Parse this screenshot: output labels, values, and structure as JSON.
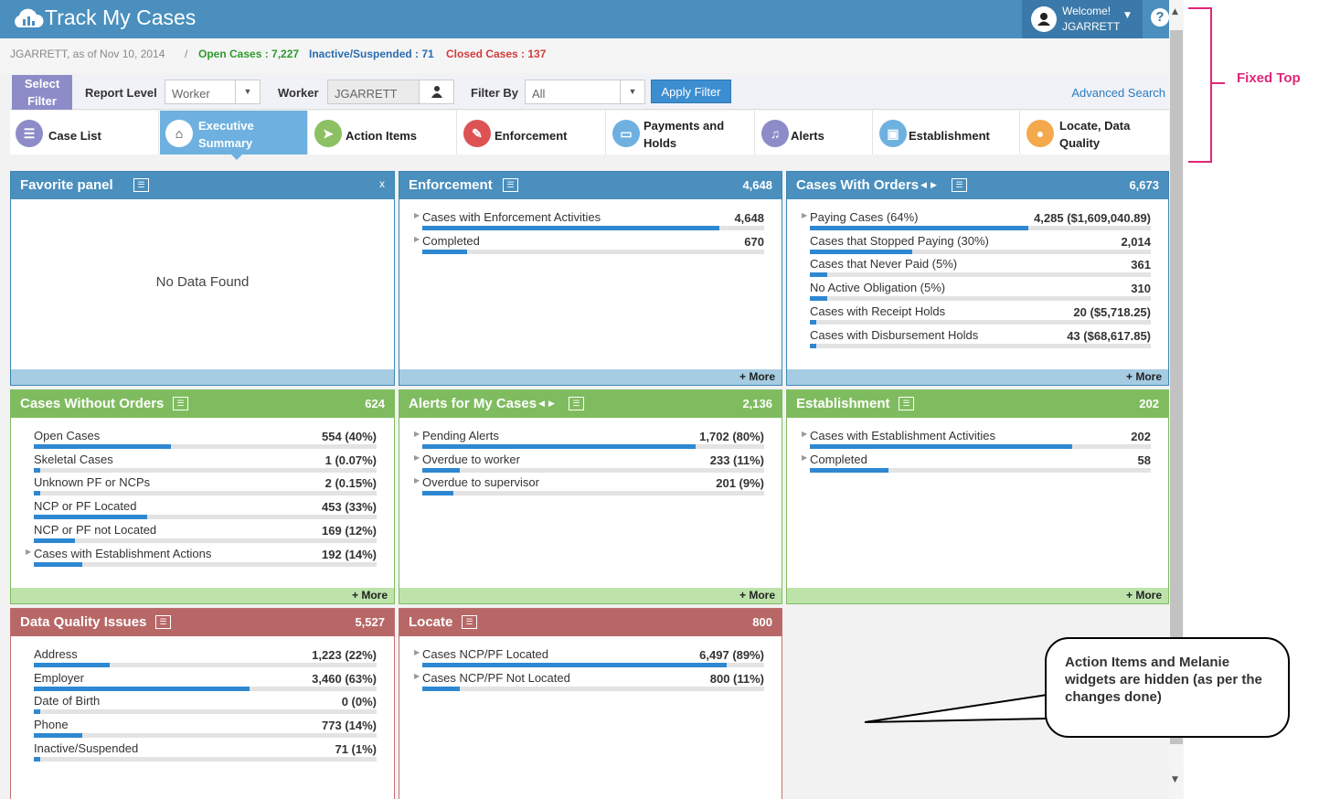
{
  "header": {
    "title": "Track My Cases",
    "welcome": "Welcome!",
    "user": "JGARRETT",
    "help": "?"
  },
  "subheader": {
    "user_date": "JGARRETT, as of Nov 10, 2014",
    "separator": "/",
    "open_label": "Open Cases : ",
    "open_value": "7,227",
    "inactive_label": "Inactive/Suspended : ",
    "inactive_value": "71",
    "closed_label": "Closed Cases : ",
    "closed_value": "137",
    "colors": {
      "open": "#2e9a2e",
      "inactive": "#2b6cb0",
      "closed": "#d23c3c"
    }
  },
  "filter": {
    "select_filter_line1": "Select",
    "select_filter_line2": "Filter",
    "report_level_label": "Report Level",
    "report_level_value": "Worker",
    "worker_label": "Worker",
    "worker_value": "JGARRETT",
    "filter_by_label": "Filter By",
    "filter_by_value": "All",
    "apply": "Apply Filter",
    "advanced": "Advanced Search"
  },
  "tabs": [
    {
      "label": "Case List",
      "icon": "list-icon",
      "color": "#8d8cc9"
    },
    {
      "label1": "Executive",
      "label2": "Summary",
      "icon": "home-icon",
      "active": true
    },
    {
      "label": "Action Items",
      "icon": "send-icon",
      "color": "#8cc063"
    },
    {
      "label": "Enforcement",
      "icon": "gavel-icon",
      "color": "#dd5353"
    },
    {
      "label1": "Payments and",
      "label2": "Holds",
      "icon": "money-icon",
      "color": "#6eb1e0"
    },
    {
      "label": "Alerts",
      "icon": "bell-icon",
      "color": "#8d8cc9"
    },
    {
      "label": "Establishment",
      "icon": "briefcase-icon",
      "color": "#6eb1e0"
    },
    {
      "label1": "Locate, Data",
      "label2": "Quality",
      "icon": "map-pin-icon",
      "color": "#f3a94c"
    }
  ],
  "panels": {
    "favorite": {
      "title": "Favorite panel",
      "close": "x",
      "empty": "No Data Found"
    },
    "enforcement": {
      "title": "Enforcement",
      "count": "4,648",
      "more": "+ More",
      "rows": [
        {
          "label": "Cases with Enforcement Activities",
          "value": "4,648",
          "pct": 0.87,
          "expand": true
        },
        {
          "label": "Completed",
          "value": "670",
          "pct": 0.13,
          "expand": true
        }
      ]
    },
    "orders": {
      "title": "Cases With Orders",
      "count": "6,673",
      "more": "+ More",
      "rows": [
        {
          "label": "Paying Cases (64%)",
          "value": "4,285 ($1,609,040.89)",
          "pct": 0.64,
          "expand": true
        },
        {
          "label": "Cases that Stopped Paying (30%)",
          "value": "2,014",
          "pct": 0.3
        },
        {
          "label": "Cases that Never Paid (5%)",
          "value": "361",
          "pct": 0.05
        },
        {
          "label": "No Active Obligation (5%)",
          "value": "310",
          "pct": 0.05
        },
        {
          "label": "Cases with Receipt Holds",
          "value": "20 ($5,718.25)",
          "pct": 0.01
        },
        {
          "label": "Cases with Disbursement Holds",
          "value": "43 ($68,617.85)",
          "pct": 0.01
        }
      ]
    },
    "without_orders": {
      "title": "Cases Without Orders",
      "count": "624",
      "more": "+ More",
      "rows": [
        {
          "label": "Open Cases",
          "value": "554 (40%)",
          "pct": 0.4
        },
        {
          "label": "Skeletal Cases",
          "value": "1 (0.07%)",
          "pct": 0.01
        },
        {
          "label": "Unknown PF or NCPs",
          "value": "2 (0.15%)",
          "pct": 0.01
        },
        {
          "label": "NCP or PF Located",
          "value": "453 (33%)",
          "pct": 0.33
        },
        {
          "label": "NCP or PF not Located",
          "value": "169 (12%)",
          "pct": 0.12
        },
        {
          "label": "Cases with Establishment Actions",
          "value": "192 (14%)",
          "pct": 0.14,
          "expand": true
        }
      ]
    },
    "alerts": {
      "title": "Alerts for My Cases",
      "count": "2,136",
      "more": "+ More",
      "rows": [
        {
          "label": "Pending Alerts",
          "value": "1,702 (80%)",
          "pct": 0.8,
          "expand": true
        },
        {
          "label": "Overdue to worker",
          "value": "233 (11%)",
          "pct": 0.11,
          "expand": true
        },
        {
          "label": "Overdue to supervisor",
          "value": "201 (9%)",
          "pct": 0.09,
          "expand": true
        }
      ]
    },
    "establishment": {
      "title": "Establishment",
      "count": "202",
      "more": "+ More",
      "rows": [
        {
          "label": "Cases with Establishment Activities",
          "value": "202",
          "pct": 0.77,
          "expand": true
        },
        {
          "label": "Completed",
          "value": "58",
          "pct": 0.23,
          "expand": true
        }
      ]
    },
    "data_quality": {
      "title": "Data Quality Issues",
      "count": "5,527",
      "rows": [
        {
          "label": "Address",
          "value": "1,223 (22%)",
          "pct": 0.22
        },
        {
          "label": "Employer",
          "value": "3,460 (63%)",
          "pct": 0.63
        },
        {
          "label": "Date of Birth",
          "value": "0 (0%)",
          "pct": 0
        },
        {
          "label": "Phone",
          "value": "773 (14%)",
          "pct": 0.14
        },
        {
          "label": "Inactive/Suspended",
          "value": "71 (1%)",
          "pct": 0.01
        }
      ]
    },
    "locate": {
      "title": "Locate",
      "count": "800",
      "rows": [
        {
          "label": "Cases NCP/PF Located",
          "value": "6,497 (89%)",
          "pct": 0.89,
          "expand": true
        },
        {
          "label": "Cases NCP/PF Not Located",
          "value": "800 (11%)",
          "pct": 0.11,
          "expand": true
        }
      ]
    }
  },
  "annotations": {
    "fixed_top": "Fixed Top",
    "callout": "Action Items and Melanie widgets are hidden (as per the changes done)"
  }
}
